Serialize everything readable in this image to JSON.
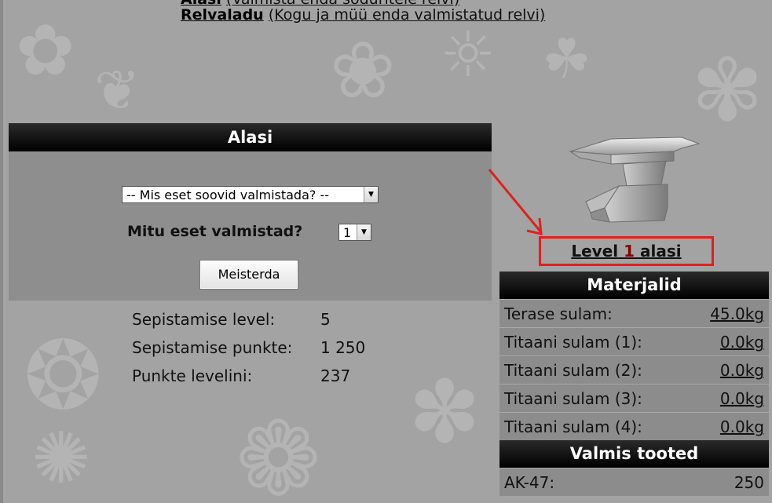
{
  "nav": {
    "first_title": "Alasi",
    "first_desc": "(Valmista enda sõduritele relvi)",
    "second_title": "Relvaladu",
    "second_desc": "(Kogu ja müü enda valmistatud relvi)"
  },
  "panel": {
    "title": "Alasi",
    "item_select_value": "-- Mis eset soovid valmistada? --",
    "qty_label": "Mitu eset valmistad?",
    "qty_select_value": "1",
    "submit_label": "Meisterda"
  },
  "stats": [
    {
      "label": "Sepistamise level:",
      "value": "5"
    },
    {
      "label": "Sepistamise punkte:",
      "value": "1 250"
    },
    {
      "label": "Punkte levelini:",
      "value": "237"
    }
  ],
  "level_badge": {
    "prefix": "Level",
    "number": "1",
    "suffix": "alasi",
    "border_color": "#e0201c",
    "number_color": "#8b0000"
  },
  "materials": {
    "title": "Materjalid",
    "rows": [
      {
        "name": "Terase sulam:",
        "value": "45.0kg"
      },
      {
        "name": "Titaani sulam (1):",
        "value": "0.0kg"
      },
      {
        "name": "Titaani sulam (2):",
        "value": "0.0kg"
      },
      {
        "name": "Titaani sulam (3):",
        "value": "0.0kg"
      },
      {
        "name": "Titaani sulam (4):",
        "value": "0.0kg"
      }
    ]
  },
  "products": {
    "title": "Valmis tooted",
    "rows": [
      {
        "name": "AK-47:",
        "value": "250"
      }
    ]
  },
  "icons": {
    "anvil": "anvil-icon",
    "arrow": "red-arrow-annotation",
    "dropdown": "chevron-down-icon"
  }
}
